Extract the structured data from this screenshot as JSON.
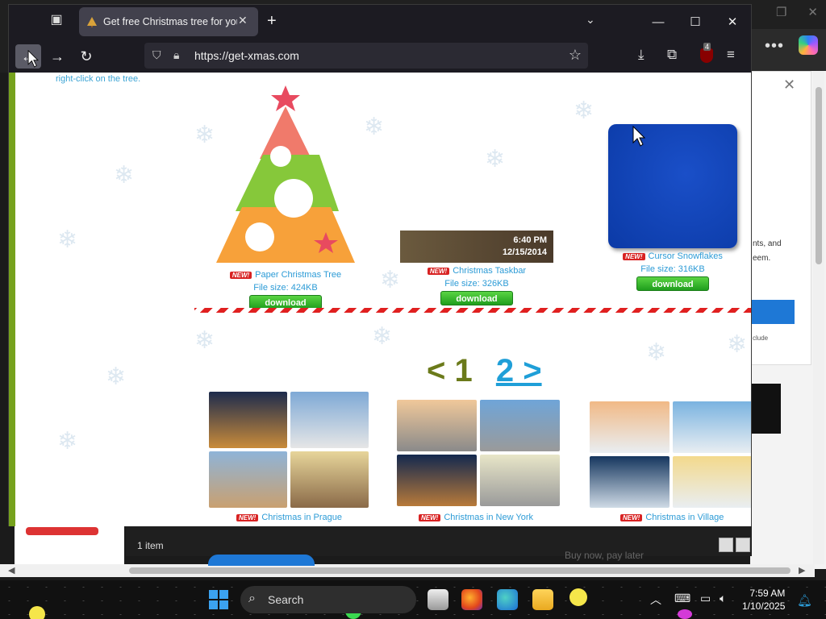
{
  "browser": {
    "tab_title": "Get free Christmas tree for your desktop",
    "url": "https://get-xmas.com",
    "extension_badge": "4"
  },
  "page": {
    "hint": "right-click on the tree.",
    "new_badge": "NEW!",
    "downloads": [
      {
        "name": "Paper Christmas Tree",
        "size": "File size: 424KB",
        "button": "download"
      },
      {
        "name": "Christmas Taskbar",
        "size": "File size: 326KB",
        "button": "download",
        "clock_time": "6:40 PM",
        "clock_date": "12/15/2014"
      },
      {
        "name": "Cursor Snowflakes",
        "size": "File size: 316KB",
        "button": "download"
      }
    ],
    "pager": {
      "current": "< 1",
      "next": "2 >"
    },
    "galleries": [
      {
        "name": "Christmas in Prague"
      },
      {
        "name": "Christmas in New York"
      },
      {
        "name": "Christmas in Village"
      }
    ]
  },
  "background": {
    "explorer_status": "1 item",
    "panel_text": [
      "nts, and",
      "eem.",
      "clude"
    ],
    "buy_now": "Buy now, pay later"
  },
  "taskbar": {
    "search_placeholder": "Search",
    "time": "7:59 AM",
    "date": "1/10/2025"
  },
  "colors": {
    "accent": "#2c9bd6",
    "page_green": "#76a21d",
    "download_green": "#2fb52a"
  }
}
